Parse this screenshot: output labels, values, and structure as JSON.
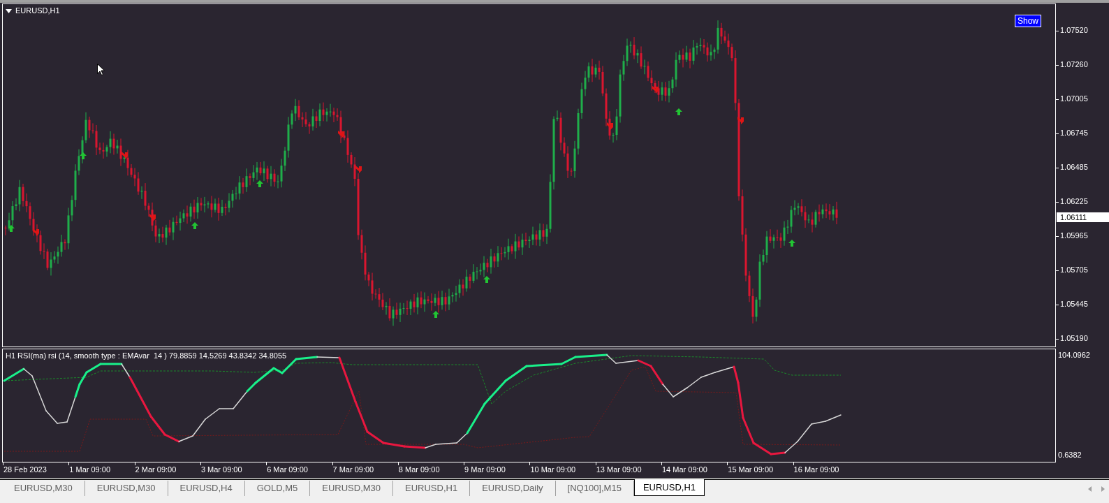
{
  "chart": {
    "title": "EURUSD,H1",
    "show_button": "Show",
    "current_price": "1.06111",
    "price_axis": [
      "1.07520",
      "1.07260",
      "1.07005",
      "1.06745",
      "1.06485",
      "1.06225",
      "1.05965",
      "1.05705",
      "1.05445",
      "1.05190"
    ]
  },
  "indicator": {
    "title": "H1 RSI(ma) rsi (14, smooth type : EMAvar  14 ) 79.8859 14.5269 43.8342 34.8055",
    "axis": [
      "104.0962",
      "0.6382"
    ]
  },
  "time_axis": [
    "28 Feb 2023",
    "1 Mar 09:00",
    "2 Mar 09:00",
    "3 Mar 09:00",
    "6 Mar 09:00",
    "7 Mar 09:00",
    "8 Mar 09:00",
    "9 Mar 09:00",
    "10 Mar 09:00",
    "13 Mar 09:00",
    "14 Mar 09:00",
    "15 Mar 09:00",
    "16 Mar 09:00"
  ],
  "tabs": [
    {
      "label": "EURUSD,M30",
      "selected": false
    },
    {
      "label": "EURUSD,M30",
      "selected": false
    },
    {
      "label": "EURUSD,H4",
      "selected": false
    },
    {
      "label": "GOLD,M5",
      "selected": false
    },
    {
      "label": "EURUSD,M30",
      "selected": false
    },
    {
      "label": "EURUSD,H1",
      "selected": false
    },
    {
      "label": "EURUSD,Daily",
      "selected": false
    },
    {
      "label": "[NQ100],M15",
      "selected": false
    },
    {
      "label": "EURUSD,H1",
      "selected": true
    }
  ]
}
